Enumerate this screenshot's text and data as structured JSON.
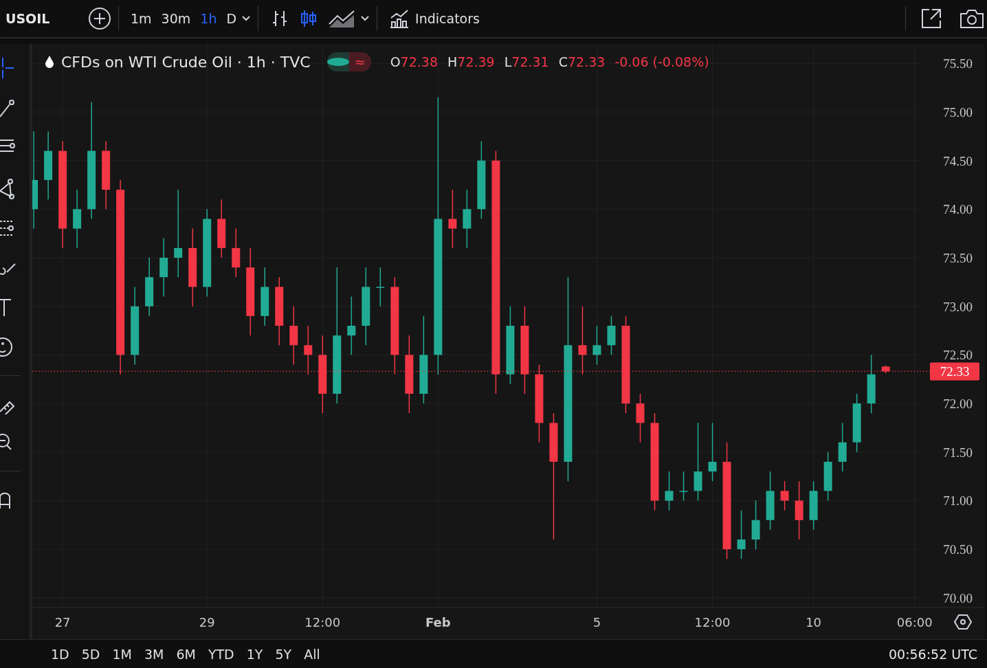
{
  "toolbar": {
    "symbol": "USOIL",
    "intervals": [
      {
        "label": "1m",
        "selected": false
      },
      {
        "label": "30m",
        "selected": false
      },
      {
        "label": "1h",
        "selected": true
      },
      {
        "label": "D",
        "selected": false
      }
    ],
    "chart_types": [
      {
        "kind": "bars",
        "selected": false
      },
      {
        "kind": "candles",
        "selected": true
      },
      {
        "kind": "area",
        "selected": false
      }
    ],
    "indicators_label": "Indicators"
  },
  "legend": {
    "title": "CFDs on WTI Crude Oil · 1h · TVC",
    "status_symbol": "≈",
    "ohlc": [
      {
        "label": "O",
        "value": "72.38"
      },
      {
        "label": "H",
        "value": "72.39"
      },
      {
        "label": "L",
        "value": "72.31"
      },
      {
        "label": "C",
        "value": "72.33"
      }
    ],
    "change": "-0.06 (-0.08%)"
  },
  "chart": {
    "chart_data": {
      "type": "candlestick",
      "grid": true,
      "ref_lines": [
        {
          "axis": "y",
          "value": 72.33,
          "label": "72.33",
          "color": "#f23645"
        }
      ],
      "categories": [
        null,
        null,
        "27",
        null,
        null,
        null,
        null,
        null,
        null,
        null,
        null,
        null,
        "29",
        null,
        null,
        null,
        null,
        null,
        null,
        null,
        "12:00",
        null,
        null,
        null,
        null,
        null,
        null,
        null,
        "Feb",
        null,
        null,
        null,
        null,
        null,
        null,
        null,
        null,
        null,
        null,
        "5",
        null,
        null,
        null,
        null,
        null,
        null,
        null,
        "12:00",
        null,
        null,
        null,
        null,
        null,
        null,
        "10",
        null,
        null,
        null,
        null,
        null,
        null,
        "06:00"
      ],
      "ylim": [
        69.9,
        75.7
      ],
      "yticks": [
        {
          "value": 70,
          "label": "70.00"
        },
        {
          "value": 70.5,
          "label": "70.50"
        },
        {
          "value": 71,
          "label": "71.00"
        },
        {
          "value": 71.5,
          "label": "71.50"
        },
        {
          "value": 72,
          "label": "72.00"
        },
        {
          "value": 72.5,
          "label": "72.50"
        },
        {
          "value": 73,
          "label": "73.00"
        },
        {
          "value": 73.5,
          "label": "73.50"
        },
        {
          "value": 74,
          "label": "74.00"
        },
        {
          "value": 74.5,
          "label": "74.50"
        },
        {
          "value": 75,
          "label": "75.00"
        },
        {
          "value": 75.5,
          "label": "75.50"
        }
      ],
      "ohlc": [
        [
          74.0,
          74.8,
          73.8,
          74.3
        ],
        [
          74.3,
          74.8,
          74.1,
          74.6
        ],
        [
          74.6,
          74.7,
          73.6,
          73.8
        ],
        [
          73.8,
          74.2,
          73.6,
          74.0
        ],
        [
          74.0,
          75.1,
          73.9,
          74.6
        ],
        [
          74.6,
          74.7,
          74.0,
          74.2
        ],
        [
          74.2,
          74.3,
          72.3,
          72.5
        ],
        [
          72.5,
          73.2,
          72.4,
          73.0
        ],
        [
          73.0,
          73.5,
          72.9,
          73.3
        ],
        [
          73.3,
          73.7,
          73.1,
          73.5
        ],
        [
          73.5,
          74.2,
          73.3,
          73.6
        ],
        [
          73.6,
          73.8,
          73.0,
          73.2
        ],
        [
          73.2,
          74.0,
          73.1,
          73.9
        ],
        [
          73.9,
          74.1,
          73.5,
          73.6
        ],
        [
          73.6,
          73.8,
          73.3,
          73.4
        ],
        [
          73.4,
          73.6,
          72.7,
          72.9
        ],
        [
          72.9,
          73.4,
          72.8,
          73.2
        ],
        [
          73.2,
          73.3,
          72.6,
          72.8
        ],
        [
          72.8,
          73.0,
          72.4,
          72.6
        ],
        [
          72.6,
          72.8,
          72.3,
          72.5
        ],
        [
          72.5,
          72.7,
          71.9,
          72.1
        ],
        [
          72.1,
          73.4,
          72.0,
          72.7
        ],
        [
          72.7,
          73.1,
          72.5,
          72.8
        ],
        [
          72.8,
          73.4,
          72.6,
          73.2
        ],
        [
          73.2,
          73.4,
          73.0,
          73.2
        ],
        [
          73.2,
          73.3,
          72.3,
          72.5
        ],
        [
          72.5,
          72.7,
          71.9,
          72.1
        ],
        [
          72.1,
          72.9,
          72.0,
          72.5
        ],
        [
          72.5,
          75.15,
          72.3,
          73.9
        ],
        [
          73.9,
          74.2,
          73.6,
          73.8
        ],
        [
          73.8,
          74.2,
          73.6,
          74.0
        ],
        [
          74.0,
          74.7,
          73.9,
          74.5
        ],
        [
          74.5,
          74.6,
          72.1,
          72.3
        ],
        [
          72.3,
          73.0,
          72.2,
          72.8
        ],
        [
          72.8,
          73.0,
          72.1,
          72.3
        ],
        [
          72.3,
          72.4,
          71.6,
          71.8
        ],
        [
          71.8,
          71.9,
          70.6,
          71.4
        ],
        [
          71.4,
          73.3,
          71.2,
          72.6
        ],
        [
          72.6,
          73.0,
          72.3,
          72.5
        ],
        [
          72.5,
          72.8,
          72.4,
          72.6
        ],
        [
          72.6,
          72.9,
          72.5,
          72.8
        ],
        [
          72.8,
          72.9,
          71.9,
          72.0
        ],
        [
          72.0,
          72.1,
          71.6,
          71.8
        ],
        [
          71.8,
          71.9,
          70.9,
          71.0
        ],
        [
          71.0,
          71.3,
          70.9,
          71.1
        ],
        [
          71.1,
          71.3,
          71.0,
          71.1
        ],
        [
          71.1,
          71.8,
          71.0,
          71.3
        ],
        [
          71.3,
          71.8,
          71.2,
          71.4
        ],
        [
          71.4,
          71.6,
          70.4,
          70.5
        ],
        [
          70.5,
          70.9,
          70.4,
          70.6
        ],
        [
          70.6,
          71.0,
          70.5,
          70.8
        ],
        [
          70.8,
          71.3,
          70.7,
          71.1
        ],
        [
          71.1,
          71.2,
          70.9,
          71.0
        ],
        [
          71.0,
          71.2,
          70.6,
          70.8
        ],
        [
          70.8,
          71.2,
          70.7,
          71.1
        ],
        [
          71.1,
          71.5,
          71.0,
          71.4
        ],
        [
          71.4,
          71.8,
          71.3,
          71.6
        ],
        [
          71.6,
          72.1,
          71.5,
          72.0
        ],
        [
          72.0,
          72.5,
          71.9,
          72.3
        ],
        [
          72.38,
          72.39,
          72.31,
          72.33
        ],
        null,
        null
      ]
    }
  },
  "ranges": [
    "1D",
    "5D",
    "1M",
    "3M",
    "6M",
    "YTD",
    "1Y",
    "5Y",
    "All"
  ],
  "clock": "00:56:52 UTC"
}
